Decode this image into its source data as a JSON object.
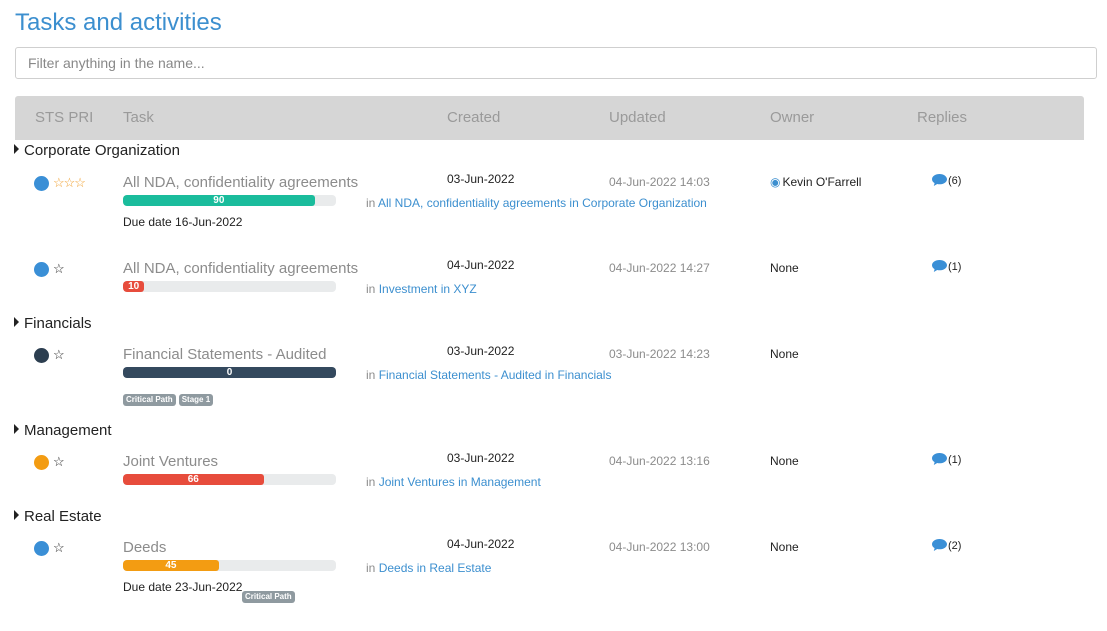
{
  "page": {
    "title": "Tasks and activities"
  },
  "filter": {
    "placeholder": "Filter anything in the name...",
    "value": ""
  },
  "columns": {
    "sts_pri": "STS PRI",
    "task": "Task",
    "created": "Created",
    "updated": "Updated",
    "owner": "Owner",
    "replies": "Replies"
  },
  "colors": {
    "status_blue": "#3a8fd6",
    "status_dark": "#2c3e50",
    "status_orange": "#f39c12",
    "bar_green": "#1abc9c",
    "bar_red": "#e74c3c",
    "bar_dark": "#34495e",
    "bar_orange": "#f39c12",
    "star_orange": "#f0a030",
    "star_dark": "#222222"
  },
  "groups": [
    {
      "name": "Corporate Organization",
      "tasks": [
        {
          "name": "All NDA, confidentiality agreements",
          "status_color": "#3a8fd6",
          "stars": "☆☆☆",
          "star_color": "#f0a030",
          "progress": 90,
          "progress_label": "90",
          "bar_color": "#1abc9c",
          "due": "Due date 16-Jun-2022",
          "created": "03-Jun-2022",
          "updated": "04-Jun-2022 14:03",
          "owner": "Kevin O'Farrell",
          "location_prefix": "in",
          "location": "All NDA, confidentiality agreements in Corporate Organization",
          "replies": "(6)"
        },
        {
          "name": "All NDA, confidentiality agreements",
          "status_color": "#3a8fd6",
          "stars": "☆",
          "star_color": "#222222",
          "progress": 10,
          "progress_label": "10",
          "bar_color": "#e74c3c",
          "created": "04-Jun-2022",
          "updated": "04-Jun-2022 14:27",
          "owner": "None",
          "location_prefix": "in",
          "location": "Investment in XYZ",
          "replies": "(1)"
        }
      ]
    },
    {
      "name": "Financials",
      "tasks": [
        {
          "name": "Financial Statements - Audited",
          "status_color": "#2c3e50",
          "stars": "☆",
          "star_color": "#222222",
          "progress": 100,
          "progress_label": "0",
          "bar_color": "#34495e",
          "tags": [
            "Critical Path",
            "Stage 1"
          ],
          "created": "03-Jun-2022",
          "updated": "03-Jun-2022 14:23",
          "owner": "None",
          "location_prefix": "in",
          "location": "Financial Statements - Audited in Financials"
        }
      ]
    },
    {
      "name": "Management",
      "tasks": [
        {
          "name": "Joint Ventures",
          "status_color": "#f39c12",
          "stars": "☆",
          "star_color": "#222222",
          "progress": 66,
          "progress_label": "66",
          "bar_color": "#e74c3c",
          "created": "03-Jun-2022",
          "updated": "04-Jun-2022 13:16",
          "owner": "None",
          "location_prefix": "in",
          "location": "Joint Ventures in Management",
          "replies": "(1)"
        }
      ]
    },
    {
      "name": "Real Estate",
      "tasks": [
        {
          "name": "Deeds",
          "status_color": "#3a8fd6",
          "stars": "☆",
          "star_color": "#222222",
          "progress": 45,
          "progress_label": "45",
          "bar_color": "#f39c12",
          "due": "Due date 23-Jun-2022",
          "due_tags": [
            "Critical Path"
          ],
          "created": "04-Jun-2022",
          "updated": "04-Jun-2022 13:00",
          "owner": "None",
          "location_prefix": "in",
          "location": "Deeds in Real Estate",
          "replies": "(2)"
        }
      ]
    }
  ]
}
